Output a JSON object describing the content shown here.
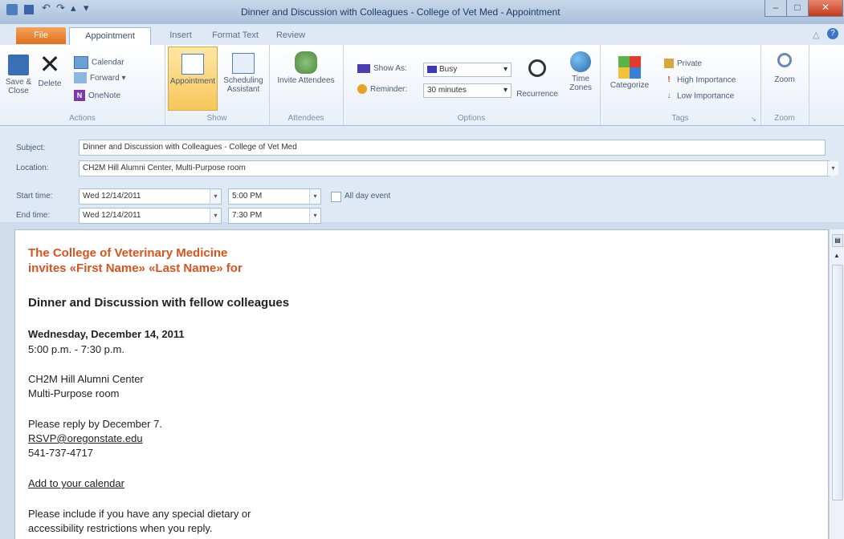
{
  "window": {
    "title": "Dinner and Discussion with Colleagues - College of Vet Med  -  Appointment"
  },
  "tabs": [
    {
      "label": "File"
    },
    {
      "label": "Appointment"
    },
    {
      "label": "Insert"
    },
    {
      "label": "Format Text"
    },
    {
      "label": "Review"
    }
  ],
  "ribbon": {
    "actions": {
      "save_close": "Save & Close",
      "delete": "Delete",
      "calendar": "Calendar",
      "forward": "Forward",
      "onenote": "OneNote",
      "group_label": "Actions"
    },
    "show": {
      "appointment": "Appointment",
      "scheduling": "Scheduling Assistant",
      "group_label": "Show"
    },
    "attendees": {
      "invite": "Invite Attendees",
      "group_label": "Attendees"
    },
    "options": {
      "show_as_label": "Show As:",
      "show_as_value": "Busy",
      "reminder_label": "Reminder:",
      "reminder_value": "30 minutes",
      "recurrence": "Recurrence",
      "time_zones": "Time Zones",
      "group_label": "Options"
    },
    "tags": {
      "categorize": "Categorize",
      "private": "Private",
      "high": "High Importance",
      "low": "Low Importance",
      "group_label": "Tags"
    },
    "zoom": {
      "zoom": "Zoom",
      "group_label": "Zoom"
    }
  },
  "form": {
    "subject_label": "Subject:",
    "subject_value": "Dinner and Discussion with Colleagues - College of Vet Med",
    "location_label": "Location:",
    "location_value": "CH2M Hill Alumni Center, Multi-Purpose room",
    "start_label": "Start time:",
    "start_date": "Wed 12/14/2011",
    "start_time": "5:00 PM",
    "all_day": "All day event",
    "end_label": "End time:",
    "end_date": "Wed 12/14/2011",
    "end_time": "7:30 PM"
  },
  "body": {
    "invite_line1": "The College of Veterinary Medicine",
    "invite_line2": "invites «First Name» «Last Name» for",
    "heading": "Dinner and Discussion with fellow colleagues",
    "date": "Wednesday, December 14, 2011",
    "time": "5:00 p.m. - 7:30 p.m.",
    "venue1": "CH2M Hill Alumni Center",
    "venue2": "Multi-Purpose room",
    "reply": "Please reply by December 7.",
    "email": "RSVP@oregonstate.edu",
    "phone": "541-737-4717",
    "add_calendar": "Add to your calendar",
    "dietary1": "Please include if you have any special dietary or",
    "dietary2": "accessibility restrictions when you reply."
  },
  "colors": {
    "accent_orange": "#d9531e",
    "ribbon_selected": "#fbd77a"
  }
}
